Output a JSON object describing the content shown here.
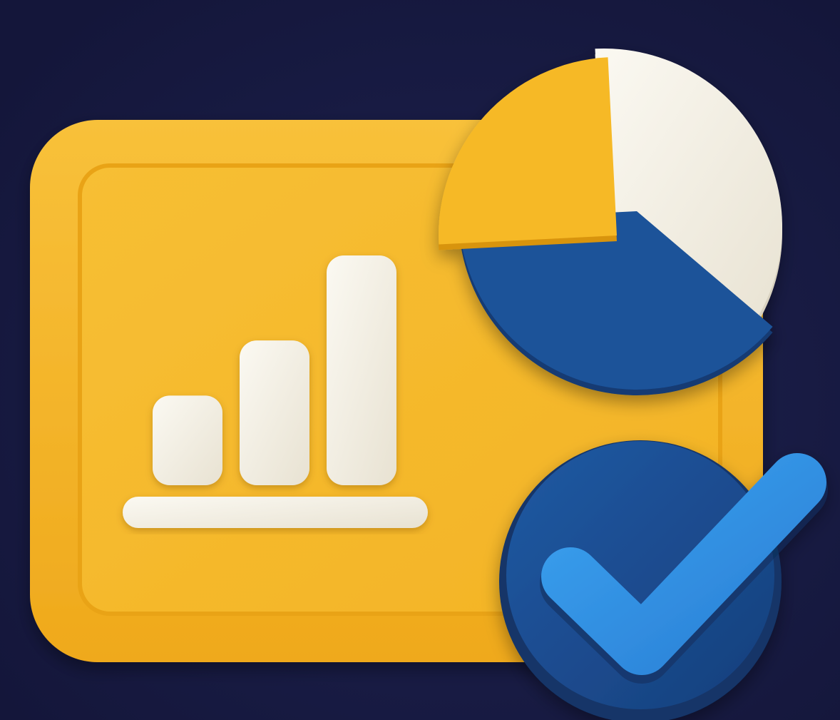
{
  "illustration": {
    "subject": "analytics-report-approved-icon",
    "icons": [
      "board-icon",
      "bar-chart-icon",
      "pie-chart-icon",
      "checkmark-badge-icon"
    ],
    "colors": {
      "background": "#16193f",
      "board": "#f6b928",
      "board_shadow": "#d8940f",
      "cream": "#f3efe4",
      "pie_blue": "#1c5299",
      "badge_blue": "#1b4d92",
      "check": "#2f8fe0"
    },
    "bar_chart": {
      "bar_levels": [
        0.39,
        0.63,
        1.0
      ]
    },
    "pie_chart": {
      "slices": [
        {
          "color_key": "cream",
          "share": 0.37
        },
        {
          "color_key": "pie_blue",
          "share": 0.38
        },
        {
          "color_key": "board",
          "share": 0.25
        }
      ]
    }
  }
}
